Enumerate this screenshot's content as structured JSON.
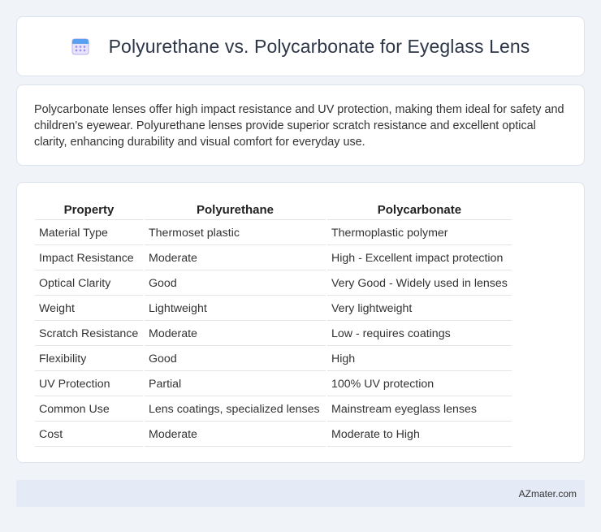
{
  "header": {
    "icon": "calendar-icon",
    "title": "Polyurethane vs. Polycarbonate for Eyeglass Lens"
  },
  "summary": {
    "text": "Polycarbonate lenses offer high impact resistance and UV protection, making them ideal for safety and children's eyewear. Polyurethane lenses provide superior scratch resistance and excellent optical clarity, enhancing durability and visual comfort for everyday use."
  },
  "table": {
    "headers": [
      "Property",
      "Polyurethane",
      "Polycarbonate"
    ],
    "rows": [
      [
        "Material Type",
        "Thermoset plastic",
        "Thermoplastic polymer"
      ],
      [
        "Impact Resistance",
        "Moderate",
        "High - Excellent impact protection"
      ],
      [
        "Optical Clarity",
        "Good",
        "Very Good - Widely used in lenses"
      ],
      [
        "Weight",
        "Lightweight",
        "Very lightweight"
      ],
      [
        "Scratch Resistance",
        "Moderate",
        "Low - requires coatings"
      ],
      [
        "Flexibility",
        "Good",
        "High"
      ],
      [
        "UV Protection",
        "Partial",
        "100% UV protection"
      ],
      [
        "Common Use",
        "Lens coatings, specialized lenses",
        "Mainstream eyeglass lenses"
      ],
      [
        "Cost",
        "Moderate",
        "Moderate to High"
      ]
    ]
  },
  "footer": {
    "brand": "AZmater.com"
  }
}
